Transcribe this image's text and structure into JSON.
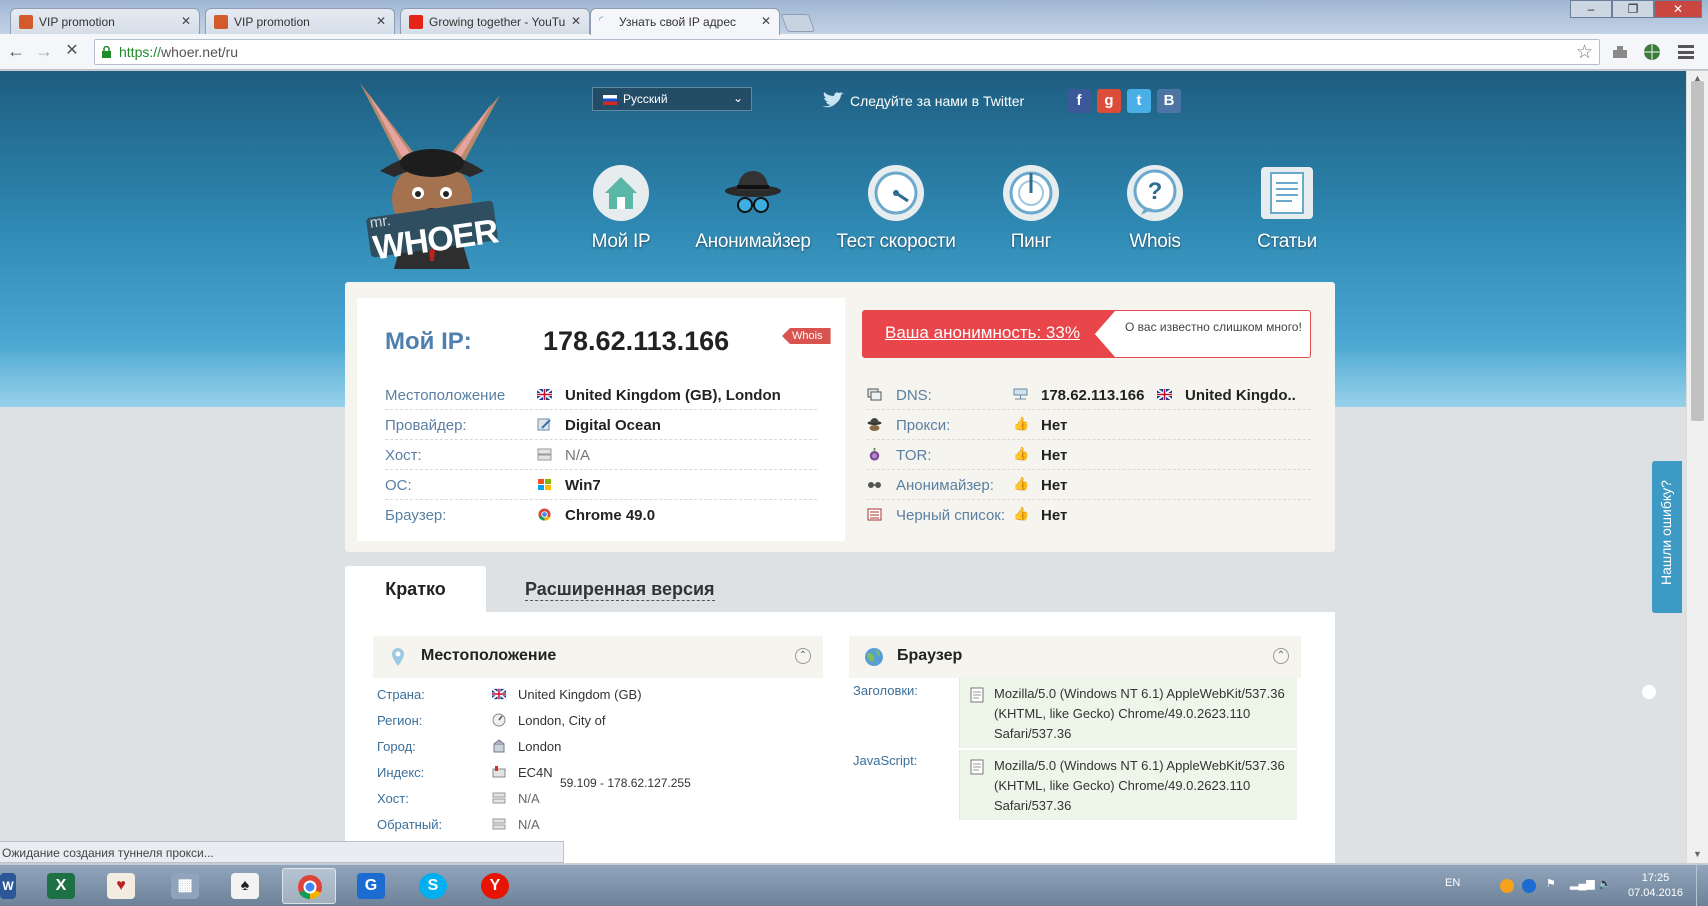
{
  "browser": {
    "tabs": [
      {
        "title": "VIP promotion",
        "favicon_color": "#d35a2a"
      },
      {
        "title": "VIP promotion",
        "favicon_color": "#d35a2a"
      },
      {
        "title": "Growing together - YouTu",
        "favicon_color": "#e62117"
      },
      {
        "title": "Узнать свой IP адрес",
        "favicon_color": "#4a90c8"
      }
    ],
    "url_protocol": "https://",
    "url_rest": "whoer.net/ru",
    "status_text": "Ожидание создания туннеля прокси..."
  },
  "header": {
    "mascot_text": "WHOER",
    "mascot_prefix": "mr.",
    "language": "Русский",
    "twitter_text": "Следуйте за нами в Twitter",
    "social": [
      {
        "letter": "f",
        "color": "#3b5998",
        "icon": "facebook-icon"
      },
      {
        "letter": "g",
        "color": "#dd4b39",
        "icon": "google-plus-icon"
      },
      {
        "letter": "t",
        "color": "#4aaee7",
        "icon": "twitter-icon"
      },
      {
        "letter": "B",
        "color": "#4c75a3",
        "icon": "vk-icon"
      }
    ],
    "nav": [
      {
        "label": "Мой IP",
        "icon": "house-icon"
      },
      {
        "label": "Анонимайзер",
        "icon": "spy-hat-icon"
      },
      {
        "label": "Тест скорости",
        "icon": "speedometer-icon"
      },
      {
        "label": "Пинг",
        "icon": "radar-icon"
      },
      {
        "label": "Whois",
        "icon": "question-bubble-icon"
      },
      {
        "label": "Статьи",
        "icon": "document-icon"
      }
    ]
  },
  "ipinfo": {
    "myip_label": "Мой IP:",
    "myip_value": "178.62.113.166",
    "whois_tag": "Whois",
    "left_rows": [
      {
        "key": "Местоположение",
        "value": "United Kingdom (GB), London",
        "icon": "uk-flag-icon"
      },
      {
        "key": "Провайдер:",
        "value": "Digital Ocean",
        "icon": "provider-icon"
      },
      {
        "key": "Хост:",
        "value": "N/A",
        "icon": "server-icon"
      },
      {
        "key": "ОС:",
        "value": "Win7",
        "icon": "windows-icon"
      },
      {
        "key": "Браузер:",
        "value": "Chrome 49.0",
        "icon": "chrome-icon"
      }
    ],
    "anonymity": "Ваша анонимность: 33%",
    "anonymity_note": "О вас известно слишком много!",
    "right_rows": [
      {
        "key": "DNS:",
        "value": "178.62.113.166",
        "extra": "United Kingdo..",
        "icon": "dns-icon"
      },
      {
        "key": "Прокси:",
        "value": "Нет",
        "icon": "spy-icon"
      },
      {
        "key": "TOR:",
        "value": "Нет",
        "icon": "tor-onion-icon"
      },
      {
        "key": "Анонимайзер:",
        "value": "Нет",
        "icon": "glasses-icon"
      },
      {
        "key": "Черный список:",
        "value": "Нет",
        "icon": "list-icon"
      }
    ]
  },
  "details": {
    "tab_short": "Кратко",
    "tab_extended": "Расширенная версия",
    "location_title": "Местоположение",
    "browser_title": "Браузер",
    "location_rows": [
      {
        "key": "Страна:",
        "value": "United Kingdom (GB)",
        "icon": "uk-flag-icon"
      },
      {
        "key": "Регион:",
        "value": "London, City of",
        "icon": "compass-icon"
      },
      {
        "key": "Город:",
        "value": "London",
        "icon": "city-icon"
      },
      {
        "key": "Индекс:",
        "value": "EC4N",
        "icon": "mailbox-icon"
      },
      {
        "key": "Хост:",
        "value": "N/A",
        "icon": "server-icon"
      },
      {
        "key": "Обратный:",
        "value": "N/A",
        "icon": "server-icon"
      }
    ],
    "range_text": "59.109 - 178.62.127.255",
    "headers_label": "Заголовки:",
    "headers_value": "Mozilla/5.0 (Windows NT 6.1) AppleWebKit/537.36 (KHTML, like Gecko) Chrome/49.0.2623.110 Safari/537.36",
    "js_label": "JavaScript:",
    "js_value": "Mozilla/5.0 (Windows NT 6.1) AppleWebKit/537.36 (KHTML, like Gecko) Chrome/49.0.2623.110 Safari/537.36"
  },
  "feedback": "Нашли ошибку?",
  "taskbar": {
    "lang": "EN",
    "time": "17:25",
    "date": "07.04.2016"
  }
}
